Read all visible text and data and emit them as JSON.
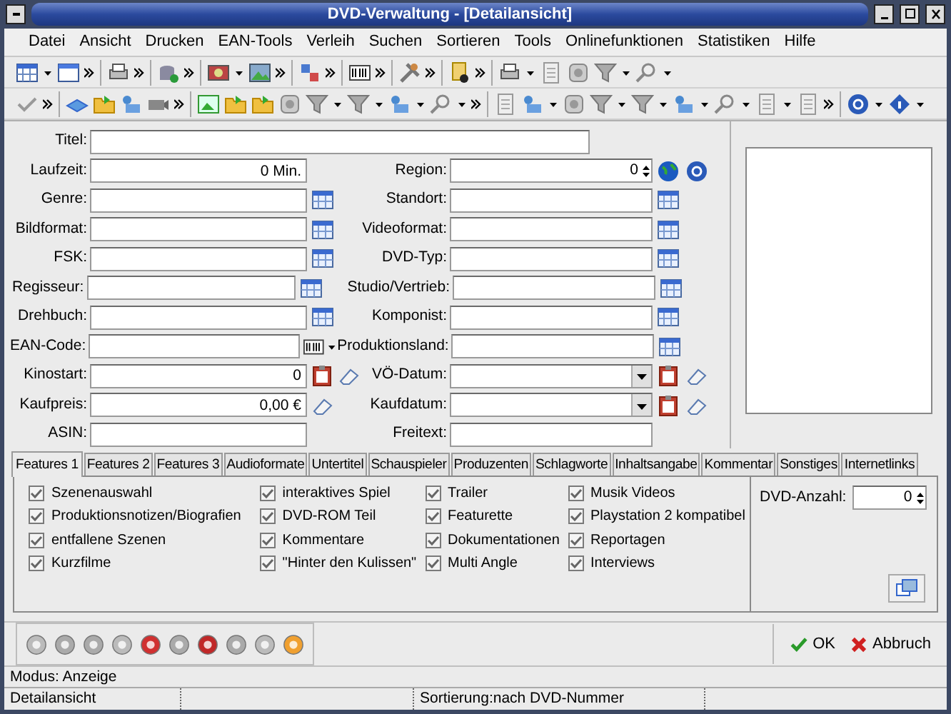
{
  "window": {
    "title": "DVD-Verwaltung - [Detailansicht]"
  },
  "menu": [
    "Datei",
    "Ansicht",
    "Drucken",
    "EAN-Tools",
    "Verleih",
    "Suchen",
    "Sortieren",
    "Tools",
    "Onlinefunktionen",
    "Statistiken",
    "Hilfe"
  ],
  "title_field": {
    "label": "Titel:"
  },
  "fields_left": [
    {
      "label": "Laufzeit:",
      "value": "0 Min.",
      "kind": "number"
    },
    {
      "label": "Genre:",
      "kind": "lookup"
    },
    {
      "label": "Bildformat:",
      "kind": "lookup"
    },
    {
      "label": "FSK:",
      "kind": "lookup"
    },
    {
      "label": "Regisseur:",
      "kind": "lookup"
    },
    {
      "label": "Drehbuch:",
      "kind": "lookup"
    },
    {
      "label": "EAN-Code:",
      "kind": "ean"
    },
    {
      "label": "Kinostart:",
      "value": "0",
      "kind": "date"
    },
    {
      "label": "Kaufpreis:",
      "value": "0,00 €",
      "kind": "price"
    },
    {
      "label": "ASIN:",
      "kind": "text"
    }
  ],
  "fields_right": [
    {
      "label": "Region:",
      "value": "0",
      "kind": "region"
    },
    {
      "label": "Standort:",
      "kind": "lookup"
    },
    {
      "label": "Videoformat:",
      "kind": "lookup"
    },
    {
      "label": "DVD-Typ:",
      "kind": "lookup"
    },
    {
      "label": "Studio/Vertrieb:",
      "kind": "lookup"
    },
    {
      "label": "Komponist:",
      "kind": "lookup"
    },
    {
      "label": "Produktionsland:",
      "kind": "lookup"
    },
    {
      "label": "VÖ-Datum:",
      "kind": "combo-date"
    },
    {
      "label": "Kaufdatum:",
      "kind": "combo-date"
    },
    {
      "label": "Freitext:",
      "kind": "text"
    }
  ],
  "tabs": [
    {
      "label": "Features 1",
      "selected": true
    },
    {
      "label": "Features 2",
      "selected": false
    },
    {
      "label": "Features 3",
      "selected": false
    },
    {
      "label": "Audioformate",
      "selected": false
    },
    {
      "label": "Untertitel",
      "selected": false
    },
    {
      "label": "Schauspieler",
      "selected": false
    },
    {
      "label": "Produzenten",
      "selected": false
    },
    {
      "label": "Schlagworte",
      "selected": false
    },
    {
      "label": "Inhaltsangabe",
      "selected": false
    },
    {
      "label": "Kommentar",
      "selected": false
    },
    {
      "label": "Sonstiges",
      "selected": false
    },
    {
      "label": "Internetlinks",
      "selected": false
    }
  ],
  "features": [
    [
      {
        "label": "Szenenauswahl",
        "checked": true
      },
      {
        "label": "Produktionsnotizen/Biografien",
        "checked": true
      },
      {
        "label": "entfallene Szenen",
        "checked": true
      },
      {
        "label": "Kurzfilme",
        "checked": true
      }
    ],
    [
      {
        "label": "interaktives Spiel",
        "checked": true
      },
      {
        "label": "DVD-ROM Teil",
        "checked": true
      },
      {
        "label": "Kommentare",
        "checked": true
      },
      {
        "label": "\"Hinter den Kulissen\"",
        "checked": true
      }
    ],
    [
      {
        "label": "Trailer",
        "checked": true
      },
      {
        "label": "Featurette",
        "checked": true
      },
      {
        "label": "Dokumentationen",
        "checked": true
      },
      {
        "label": "Multi Angle",
        "checked": true
      }
    ],
    [
      {
        "label": "Musik Videos",
        "checked": true
      },
      {
        "label": "Playstation 2 kompatibel",
        "checked": true
      },
      {
        "label": "Reportagen",
        "checked": true
      },
      {
        "label": "Interviews",
        "checked": true
      }
    ]
  ],
  "dvd_count": {
    "label": "DVD-Anzahl:",
    "value": "0"
  },
  "actions": [
    {
      "label": "OK",
      "kind": "ok"
    },
    {
      "label": "Abbruch",
      "kind": "cancel"
    }
  ],
  "mode": "Modus: Anzeige",
  "status_bar": [
    "Detailansicht",
    "Sortierung:nach DVD-Nummer"
  ]
}
